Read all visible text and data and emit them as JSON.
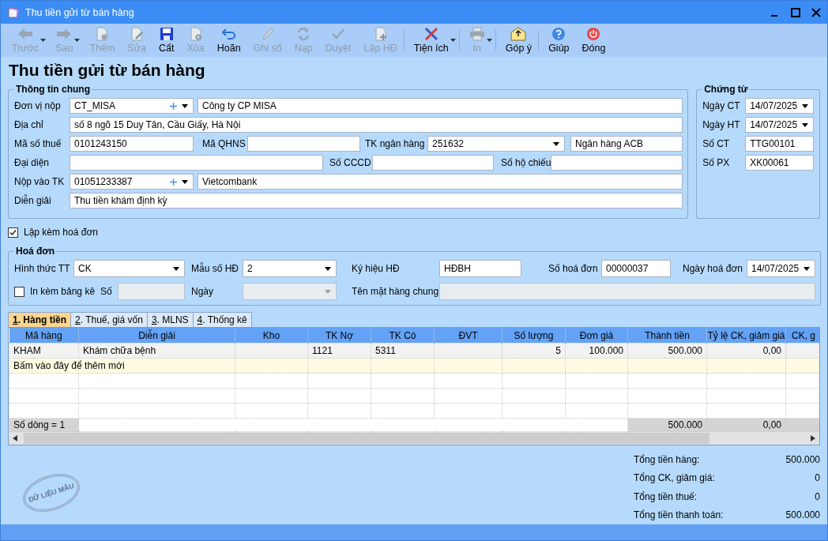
{
  "window": {
    "title": "Thu tiền gửi từ bán hàng"
  },
  "toolbar": [
    {
      "kind": "back",
      "label": "Trước",
      "disabled": true,
      "has_menu": true,
      "separator_before": false
    },
    {
      "kind": "forward",
      "label": "Sau",
      "disabled": true,
      "has_menu": true,
      "separator_before": false
    },
    {
      "kind": "add",
      "label": "Thêm",
      "disabled": true,
      "has_menu": false,
      "separator_before": false
    },
    {
      "kind": "edit",
      "label": "Sửa",
      "disabled": true,
      "has_menu": false,
      "separator_before": false
    },
    {
      "kind": "save",
      "label": "Cất",
      "disabled": false,
      "has_menu": false,
      "separator_before": false
    },
    {
      "kind": "delete",
      "label": "Xóa",
      "disabled": true,
      "has_menu": false,
      "separator_before": false
    },
    {
      "kind": "undo",
      "label": "Hoãn",
      "disabled": false,
      "has_menu": false,
      "separator_before": false
    },
    {
      "kind": "pencil",
      "label": "Ghi sổ",
      "disabled": true,
      "has_menu": false,
      "separator_before": false
    },
    {
      "kind": "refresh",
      "label": "Nạp",
      "disabled": true,
      "has_menu": false,
      "separator_before": false
    },
    {
      "kind": "check",
      "label": "Duyệt",
      "disabled": true,
      "has_menu": false,
      "separator_before": false
    },
    {
      "kind": "invoice",
      "label": "Lập HĐ",
      "disabled": true,
      "has_menu": false,
      "separator_before": false
    },
    {
      "kind": "tools",
      "label": "Tiện ích",
      "disabled": false,
      "has_menu": true,
      "separator_before": true
    },
    {
      "kind": "print",
      "label": "In",
      "disabled": true,
      "has_menu": true,
      "separator_before": true
    },
    {
      "kind": "feedback",
      "label": "Góp ý",
      "disabled": false,
      "has_menu": false,
      "separator_before": true
    },
    {
      "kind": "help",
      "label": "Giúp",
      "disabled": false,
      "has_menu": false,
      "separator_before": true
    },
    {
      "kind": "close",
      "label": "Đóng",
      "disabled": false,
      "has_menu": false,
      "separator_before": false
    }
  ],
  "heading": "Thu tiền gửi từ bán hàng",
  "general": {
    "legend": "Thông tin chung",
    "payer": {
      "label": "Đơn vị nộp",
      "code": "CT_MISA",
      "name": "Công ty CP MISA"
    },
    "address": {
      "label": "Địa chỉ",
      "value": "số 8 ngõ 15 Duy Tân, Cầu Giấy, Hà Nội"
    },
    "tax_code": {
      "label": "Mã số thuế",
      "value": "0101243150"
    },
    "qhns": {
      "label": "Mã QHNS"
    },
    "bank_account": {
      "label": "TK ngân hàng",
      "value": "251632",
      "bank": "Ngân hàng ACB"
    },
    "representative": {
      "label": "Đại diện"
    },
    "id_card": {
      "label": "Số CCCD"
    },
    "passport": {
      "label": "Số hộ chiếu"
    },
    "deposit_account": {
      "label": "Nộp vào TK",
      "code": "01051233387",
      "name": "Vietcombank"
    },
    "description": {
      "label": "Diễn giải",
      "value": "Thu tiền khám định kỳ"
    }
  },
  "voucher": {
    "legend": "Chứng từ",
    "fields": [
      {
        "kind": "date",
        "label": "Ngày CT",
        "value": "14/07/2025"
      },
      {
        "kind": "date",
        "label": "Ngày HT",
        "value": "14/07/2025"
      },
      {
        "kind": "text",
        "label": "Số CT",
        "value": "TTG00101"
      },
      {
        "kind": "text",
        "label": "Số PX",
        "value": "XK00061"
      }
    ]
  },
  "attach_invoice": {
    "label": "Lập kèm hoá đơn",
    "checked": true
  },
  "invoice": {
    "legend": "Hoá đơn",
    "payment_method": {
      "label": "Hình thức TT",
      "value": "CK"
    },
    "template": {
      "label": "Mẫu số HĐ",
      "value": "2"
    },
    "symbol": {
      "label": "Ký hiệu HĐ",
      "value": "HĐBH"
    },
    "number": {
      "label": "Số hoá đơn",
      "value": "00000037"
    },
    "date": {
      "label": "Ngày hoá đơn",
      "value": "14/07/2025"
    },
    "attach_list": {
      "label": "In kèm bảng kê",
      "checked": false
    },
    "list_number": {
      "label": "Số",
      "disabled": true
    },
    "list_date": {
      "label": "Ngày",
      "disabled": true
    },
    "common_item_name": {
      "label": "Tên mặt hàng chung",
      "disabled": true
    }
  },
  "tabs": [
    {
      "number": "1",
      "label": ". Hàng tiền",
      "selected": true
    },
    {
      "number": "2",
      "label": ". Thuế, giá vốn",
      "selected": false
    },
    {
      "number": "3",
      "label": ". MLNS",
      "selected": false
    },
    {
      "number": "4",
      "label": ". Thống kê",
      "selected": false
    }
  ],
  "grid": {
    "columns": [
      {
        "label": "Mã hàng",
        "kind": "text"
      },
      {
        "label": "Diễn giải",
        "kind": "text"
      },
      {
        "label": "Kho",
        "kind": "text"
      },
      {
        "label": "TK Nợ",
        "kind": "text"
      },
      {
        "label": "TK Có",
        "kind": "text"
      },
      {
        "label": "ĐVT",
        "kind": "text"
      },
      {
        "label": "Số lượng",
        "kind": "number"
      },
      {
        "label": "Đơn giá",
        "kind": "number"
      },
      {
        "label": "Thành tiền",
        "kind": "number"
      },
      {
        "label": "Tỷ lệ CK, giảm giá",
        "kind": "number"
      },
      {
        "label": "CK, g",
        "kind": "number"
      }
    ],
    "rows": [
      [
        "KHAM",
        "Khám chữa bệnh",
        null,
        "1121",
        "5311",
        null,
        "5",
        "100.000",
        "500.000",
        "0,00",
        null
      ]
    ],
    "new_row_hint": "Bấm vào đây để thêm mới",
    "footer": {
      "count": "Số dòng = 1",
      "amount": "500.000",
      "discount": "0,00"
    }
  },
  "totals": [
    {
      "label": "Tổng tiền hàng:",
      "value": "500.000"
    },
    {
      "label": "Tổng CK, giảm giá:",
      "value": "0"
    },
    {
      "label": "Tổng tiền thuế:",
      "value": "0"
    },
    {
      "label": "Tổng tiền thanh toán:",
      "value": "500.000"
    }
  ],
  "stamp": "DỮ LIỆU MẪU"
}
